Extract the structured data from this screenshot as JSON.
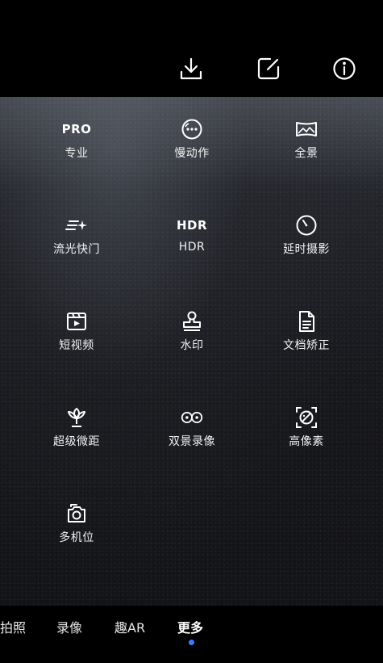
{
  "toolbar": {
    "icons": [
      "download-icon",
      "edit-icon",
      "info-icon"
    ]
  },
  "modes": [
    {
      "glyph_text": "PRO",
      "label": "专业",
      "icon": "pro-text-icon"
    },
    {
      "glyph_text": "",
      "label": "慢动作",
      "icon": "slow-motion-icon"
    },
    {
      "glyph_text": "",
      "label": "全景",
      "icon": "panorama-icon"
    },
    {
      "glyph_text": "",
      "label": "流光快门",
      "icon": "light-painting-icon"
    },
    {
      "glyph_text": "HDR",
      "label": "HDR",
      "icon": "hdr-text-icon"
    },
    {
      "glyph_text": "",
      "label": "延时摄影",
      "icon": "timelapse-icon"
    },
    {
      "glyph_text": "",
      "label": "短视频",
      "icon": "short-video-icon"
    },
    {
      "glyph_text": "",
      "label": "水印",
      "icon": "watermark-icon"
    },
    {
      "glyph_text": "",
      "label": "文档矫正",
      "icon": "document-icon"
    },
    {
      "glyph_text": "",
      "label": "超级微距",
      "icon": "super-macro-icon"
    },
    {
      "glyph_text": "",
      "label": "双景录像",
      "icon": "dual-view-icon"
    },
    {
      "glyph_text": "",
      "label": "高像素",
      "icon": "high-resolution-icon"
    },
    {
      "glyph_text": "",
      "label": "多机位",
      "icon": "multi-camera-icon"
    }
  ],
  "tabs": [
    {
      "label": "拍照"
    },
    {
      "label": "录像"
    },
    {
      "label": "趣AR"
    },
    {
      "label": "更多",
      "active": true
    }
  ],
  "colors": {
    "accent": "#3b7cff",
    "background": "#000000"
  }
}
